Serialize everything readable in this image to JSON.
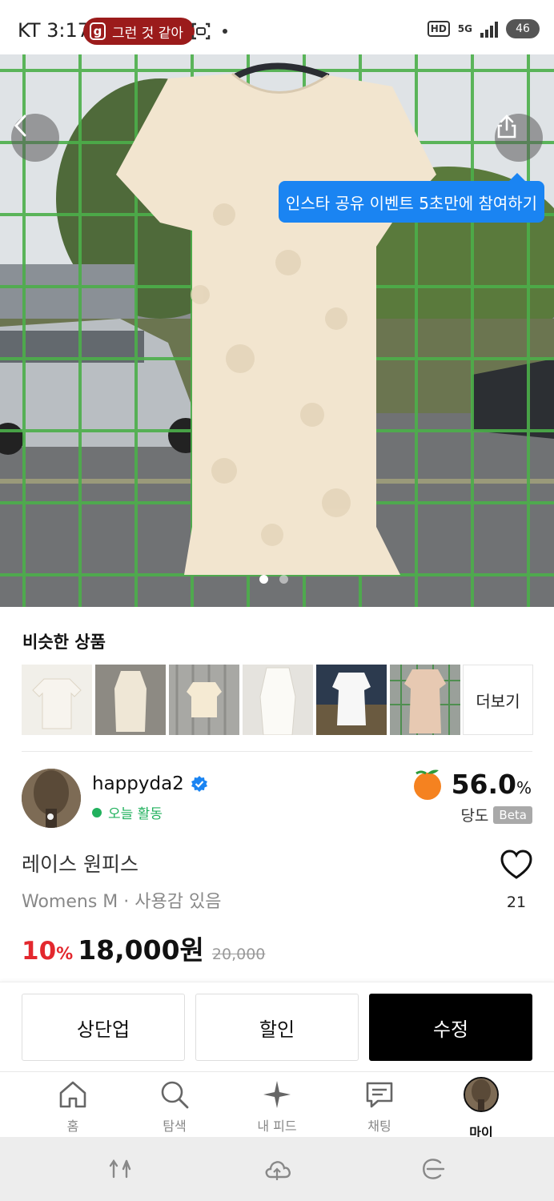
{
  "status_bar": {
    "time": "KT 3:17",
    "pill_icon": "g",
    "pill_text": "그런 것 같아",
    "hd": "HD",
    "network": "5G",
    "battery": "46"
  },
  "hero": {
    "tooltip": "인스타 공유 이벤트 5초만에 참여하기",
    "page_count": 2,
    "current_page": 1
  },
  "similar": {
    "title": "비슷한 상품",
    "more_label": "더보기"
  },
  "seller": {
    "name": "happyda2",
    "activity": "오늘 활동",
    "rating_value": "56.0",
    "rating_unit": "%",
    "rating_label": "당도",
    "beta": "Beta"
  },
  "product": {
    "title": "레이스 원피스",
    "meta": "Womens M · 사용감 있음",
    "likes": "21",
    "discount": "10",
    "discount_unit": "%",
    "price": "18,000원",
    "original_price": "20,000"
  },
  "actions": {
    "bump": "상단업",
    "discount": "할인",
    "edit": "수정"
  },
  "tabs": {
    "home": "홈",
    "search": "탐색",
    "feed": "내 피드",
    "chat": "채팅",
    "my": "마이"
  },
  "colors": {
    "accent_blue": "#1a84f2",
    "discount_red": "#e3282e",
    "active_green": "#21b15d",
    "pill_red": "#9b1b1b"
  }
}
